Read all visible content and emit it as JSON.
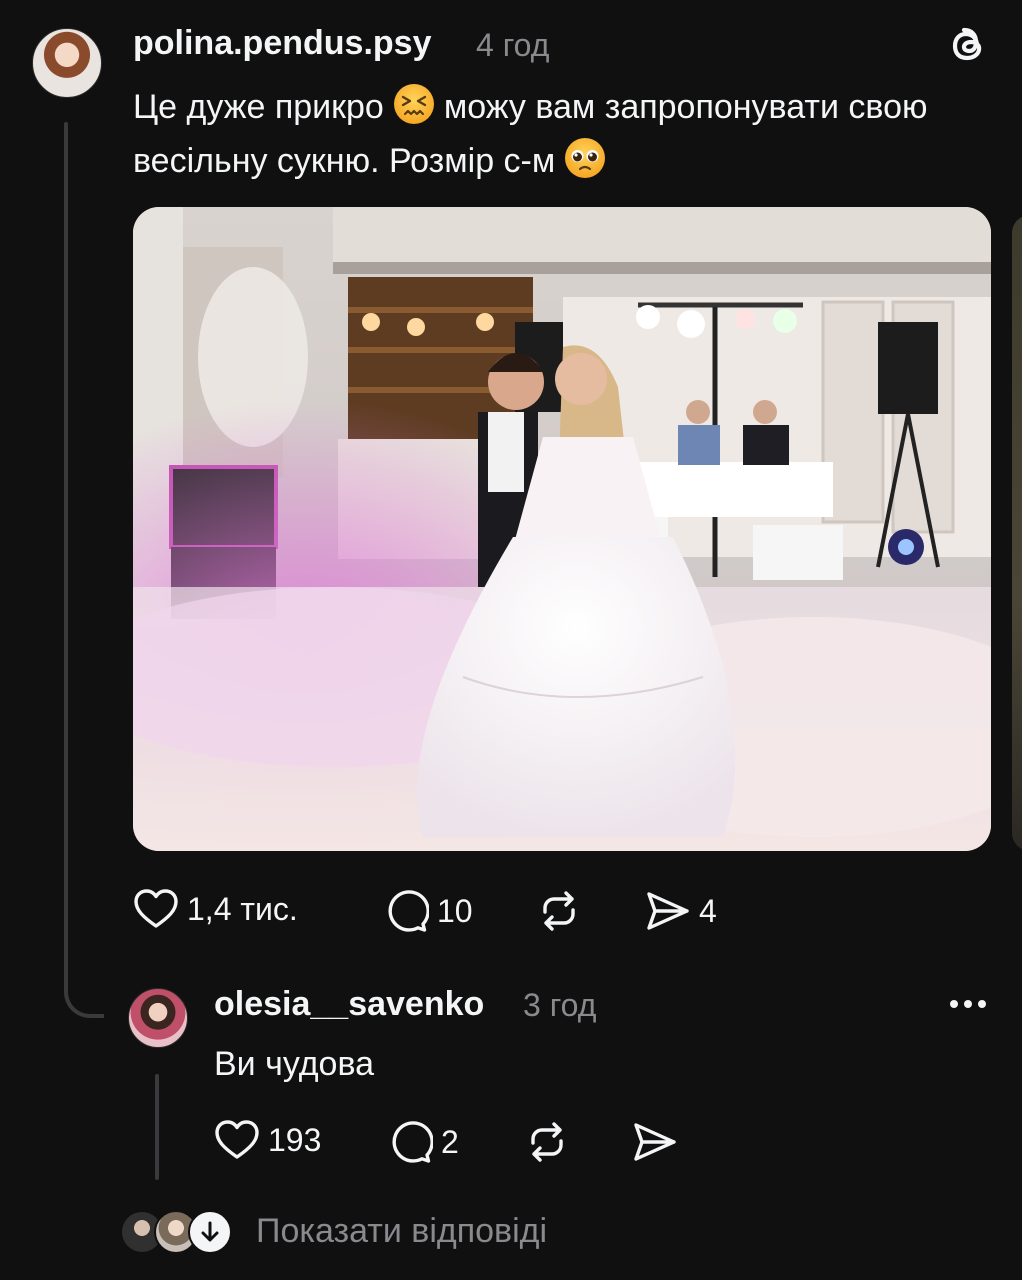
{
  "post": {
    "username": "polina.pendus.psy",
    "time": "4 год",
    "text_part1": "Це дуже прикро",
    "emoji1": "confounded-face",
    "text_part2": "можу вам запропонувати свою весільну сукню. Розмір с-м",
    "emoji2": "pleading-face",
    "image_alt": "wedding first dance photo",
    "actions": {
      "likes": "1,4 тис.",
      "comments": "10",
      "shares": "4"
    }
  },
  "reply": {
    "username": "olesia__savenko",
    "time": "3 год",
    "text": "Ви чудова",
    "actions": {
      "likes": "193",
      "comments": "2"
    }
  },
  "show_replies": {
    "label": "Показати відповіді"
  },
  "icons": {
    "app_logo": "threads-logo-icon",
    "like": "heart-icon",
    "comment": "comment-icon",
    "repost": "repost-icon",
    "share": "send-icon",
    "more": "more-icon",
    "expand": "arrow-down-icon"
  },
  "colors": {
    "background": "#101010",
    "text": "#f3f5f7",
    "secondary_text": "#8a8a8e",
    "thread_line": "#3a3a3c"
  }
}
